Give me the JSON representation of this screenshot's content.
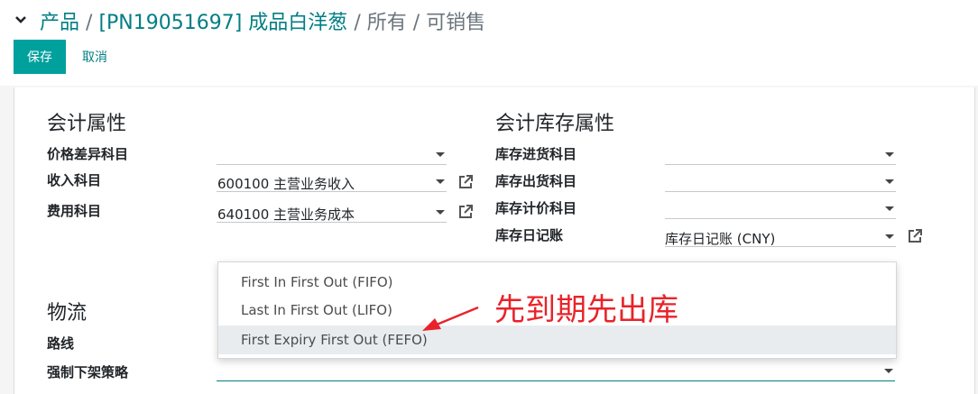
{
  "breadcrumb": {
    "items": [
      "产品",
      "[PN19051697] 成品白洋葱",
      "所有"
    ],
    "separator": "/",
    "current": "可销售",
    "toggle_icon": "chevron-down-icon"
  },
  "actions": {
    "save_label": "保存",
    "cancel_label": "取消"
  },
  "accounting": {
    "title": "会计属性",
    "fields": [
      {
        "label": "价格差异科目",
        "value": ""
      },
      {
        "label": "收入科目",
        "value": "600100 主营业务收入"
      },
      {
        "label": "费用科目",
        "value": "640100 主营业务成本"
      }
    ]
  },
  "stock_accounting": {
    "title": "会计库存属性",
    "fields": [
      {
        "label": "库存进货科目",
        "value": ""
      },
      {
        "label": "库存出货科目",
        "value": ""
      },
      {
        "label": "库存计价科目",
        "value": ""
      },
      {
        "label": "库存日记账",
        "value": "库存日记账 (CNY)"
      }
    ]
  },
  "logistics": {
    "title": "物流",
    "fields": [
      {
        "label": "路线"
      },
      {
        "label": "强制下架策略",
        "value": ""
      }
    ]
  },
  "removal_dropdown": {
    "options": [
      "First In First Out (FIFO)",
      "Last In First Out (LIFO)",
      "First Expiry First Out (FEFO)"
    ],
    "highlighted_index": 2
  },
  "annotation": {
    "text": "先到期先出库",
    "color": "#e8232a"
  },
  "colors": {
    "primary": "#00a09d",
    "link": "#017e84",
    "muted": "#6c757d"
  }
}
